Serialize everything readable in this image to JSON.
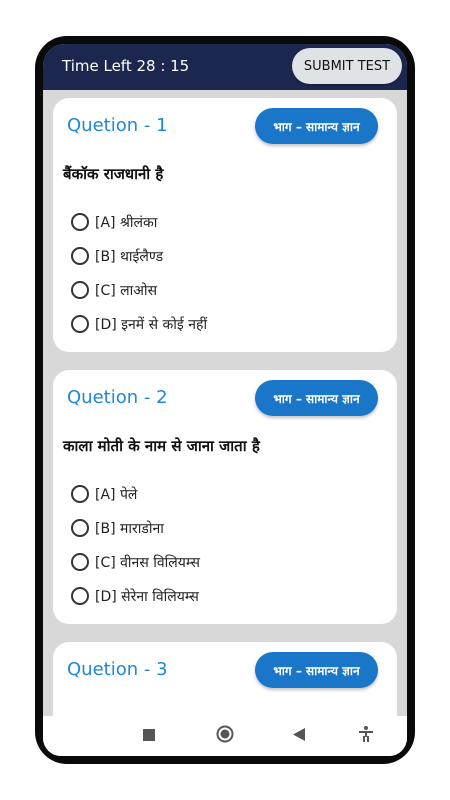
{
  "header": {
    "timer": "Time Left 28 : 15",
    "submit_label": "SUBMIT TEST"
  },
  "questions": [
    {
      "title": "Quetion - 1",
      "category": "भाग – सामान्य ज्ञान",
      "text": "बैंकॉक राजधानी है",
      "options": [
        "[A] श्रीलंका",
        "[B] थाईलैण्ड",
        "[C] लाओस",
        "[D] इनमें से कोई नहीं"
      ]
    },
    {
      "title": "Quetion - 2",
      "category": "भाग – सामान्य ज्ञान",
      "text": "काला मोती के नाम से जाना जाता है",
      "options": [
        "[A] पेले",
        "[B] माराडोना",
        "[C] वीनस विलियम्स",
        "[D] सेरेना विलियम्स"
      ]
    },
    {
      "title": "Quetion - 3",
      "category": "भाग – सामान्य ज्ञान",
      "text": "",
      "options": []
    }
  ],
  "navbar": {
    "icons": [
      "square-icon",
      "circle-icon",
      "back-triangle-icon",
      "accessibility-icon"
    ]
  },
  "colors": {
    "topbar": "#1c2750",
    "accent": "#1e88d8",
    "badge": "#1976c9"
  }
}
